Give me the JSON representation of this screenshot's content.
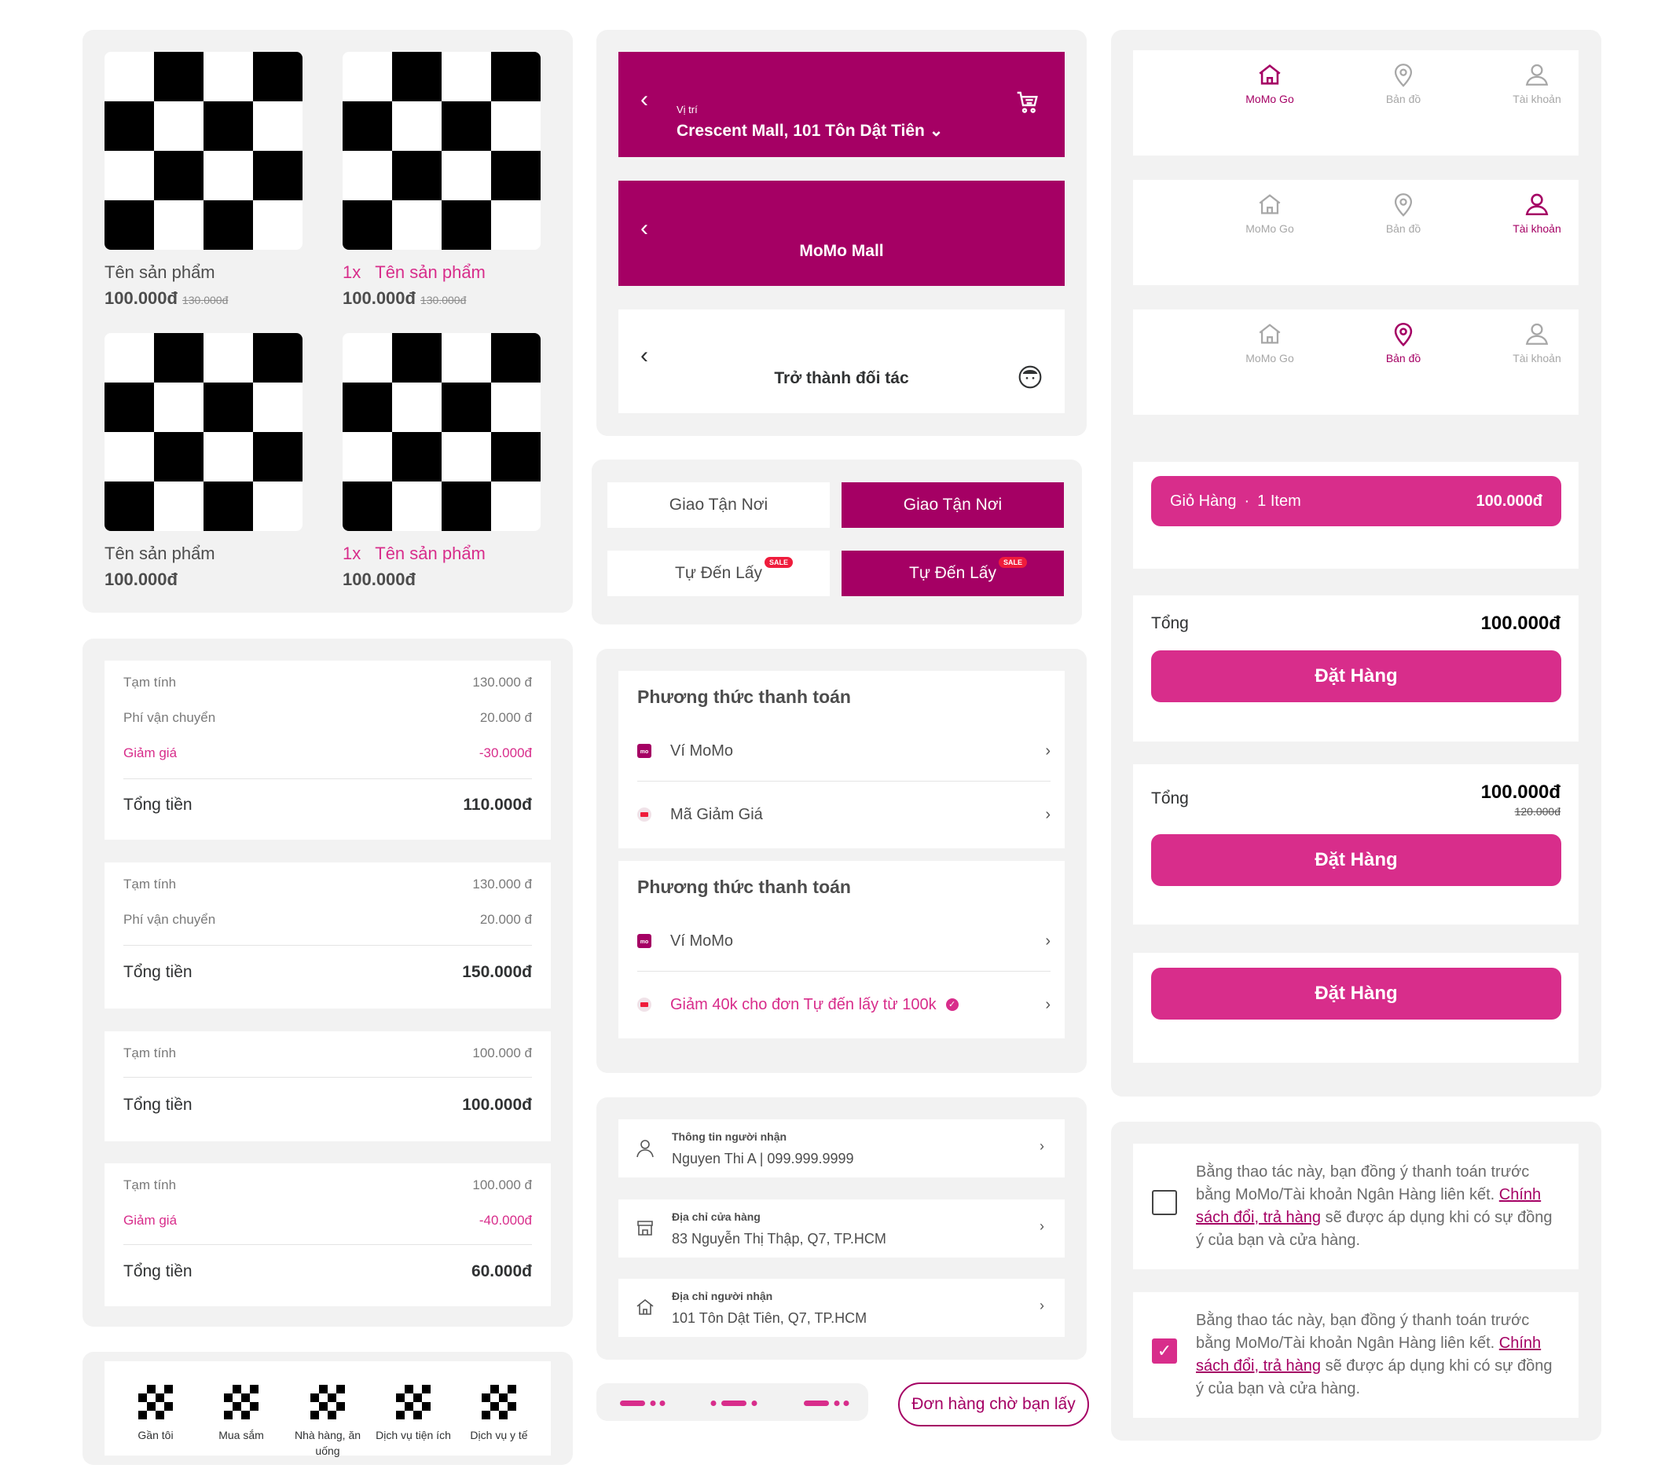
{
  "products": [
    {
      "name": "Tên sản phẩm",
      "qty": "",
      "price": "100.000đ",
      "old_price": "130.000đ"
    },
    {
      "name": "Tên sản phẩm",
      "qty": "1x",
      "price": "100.000đ",
      "old_price": "130.000đ"
    },
    {
      "name": "Tên sản phẩm",
      "qty": "",
      "price": "100.000đ",
      "old_price": ""
    },
    {
      "name": "Tên sản phẩm",
      "qty": "1x",
      "price": "100.000đ",
      "old_price": ""
    }
  ],
  "headers": {
    "location_caption": "Vị trí",
    "location_value": "Crescent Mall, 101 Tôn Dật Tiên",
    "mall_title": "MoMo Mall",
    "partner_title": "Trở thành đối tác"
  },
  "tabs": {
    "delivery": "Giao Tận Nơi",
    "pickup": "Tự Đến Lấy",
    "sale_badge": "SALE"
  },
  "summaries": [
    {
      "rows": [
        {
          "label": "Tạm tính",
          "value": "130.000 đ"
        },
        {
          "label": "Phí vận chuyển",
          "value": "20.000 đ"
        },
        {
          "label": "Giảm giá",
          "value": "-30.000đ"
        }
      ],
      "total_label": "Tổng tiền",
      "total": "110.000đ"
    },
    {
      "rows": [
        {
          "label": "Tạm tính",
          "value": "130.000 đ"
        },
        {
          "label": "Phí vận chuyển",
          "value": "20.000 đ"
        }
      ],
      "total_label": "Tổng tiền",
      "total": "150.000đ"
    },
    {
      "rows": [
        {
          "label": "Tạm tính",
          "value": "100.000 đ"
        }
      ],
      "total_label": "Tổng tiền",
      "total": "100.000đ"
    },
    {
      "rows": [
        {
          "label": "Tạm tính",
          "value": "100.000 đ"
        },
        {
          "label": "Giảm giá",
          "value": "-40.000đ"
        }
      ],
      "total_label": "Tổng tiền",
      "total": "60.000đ"
    }
  ],
  "categories": [
    "Gần tôi",
    "Mua sắm",
    "Nhà hàng, ăn uống",
    "Dịch vụ tiện ích",
    "Dịch vụ y tế"
  ],
  "payment": [
    {
      "title": "Phương thức thanh toán",
      "wallet": "Ví MoMo",
      "voucher": "Mã Giảm Giá"
    },
    {
      "title": "Phương thức thanh toán",
      "wallet": "Ví MoMo",
      "voucher": "Giảm 40k cho đơn Tự đến lấy từ 100k"
    }
  ],
  "info": [
    {
      "title": "Thông tin người nhận",
      "value": "Nguyen Thi A | 099.999.9999"
    },
    {
      "title": "Địa chỉ cửa hàng",
      "value": "83 Nguyễn Thị Thập, Q7, TP.HCM"
    },
    {
      "title": "Địa chỉ người nhận",
      "value": "101 Tôn Dật Tiên, Q7, TP.HCM"
    }
  ],
  "waiting_button": "Đơn hàng chờ bạn lấy",
  "bottom_nav": {
    "home": "MoMo Go",
    "map": "Bản đồ",
    "account": "Tài khoản"
  },
  "cart": {
    "label": "Giỏ Hàng",
    "items": "1 Item",
    "total": "100.000đ"
  },
  "checkout": [
    {
      "total_label": "Tổng",
      "total": "100.000đ",
      "old_total": "",
      "button": "Đặt Hàng"
    },
    {
      "total_label": "Tổng",
      "total": "100.000đ",
      "old_total": "120.000đ",
      "button": "Đặt Hàng"
    },
    {
      "button": "Đặt Hàng"
    }
  ],
  "agreement": {
    "text1": "Bằng thao tác này, bạn đồng ý thanh toán trước bằng MoMo/Tài khoản Ngân Hàng liên kết.",
    "link": "Chính sách đổi, trả hàng",
    "text2": "sẽ được áp dụng khi có sự đồng ý của bạn và cửa hàng."
  },
  "colors": {
    "brand": "#a50064",
    "accent": "#d82d8b",
    "panel": "#f2f2f2"
  }
}
